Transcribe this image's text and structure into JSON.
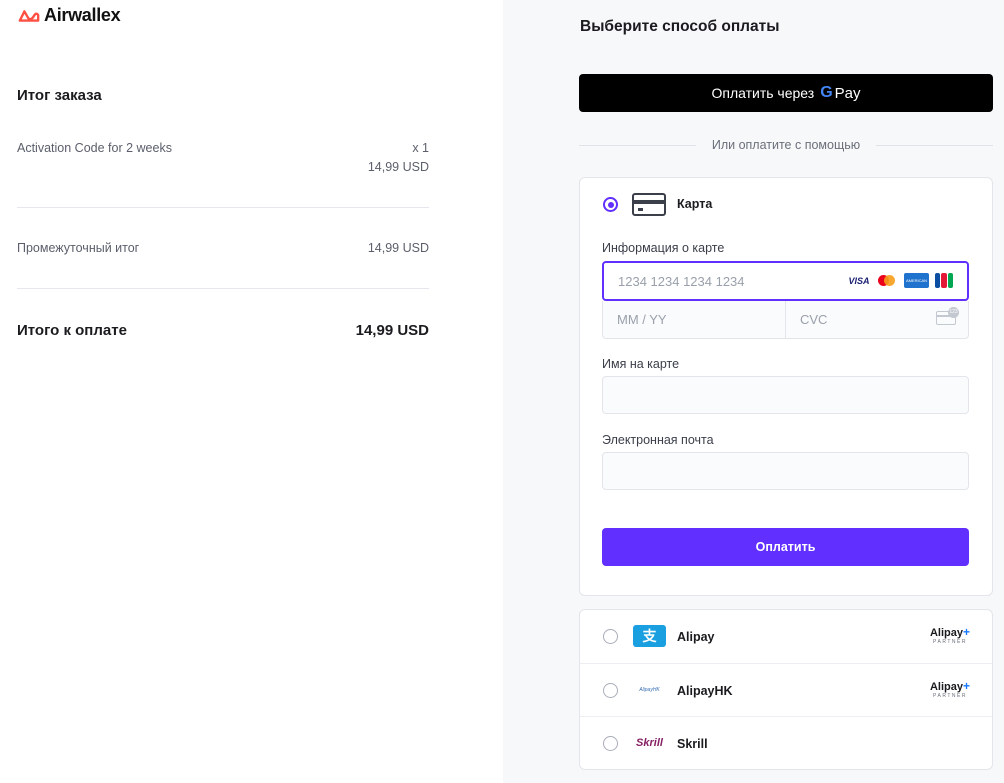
{
  "brand": {
    "name": "Airwallex",
    "accent": "#ff4f42"
  },
  "summary": {
    "title": "Итог заказа",
    "item": {
      "name": "Activation Code for 2 weeks",
      "qty": "x 1",
      "price": "14,99 USD"
    },
    "subtotal_label": "Промежуточный итог",
    "subtotal_value": "14,99 USD",
    "total_label": "Итого к оплате",
    "total_value": "14,99 USD"
  },
  "payment": {
    "title": "Выберите способ оплаты",
    "gpay_label": "Оплатить через",
    "gpay_g": "G",
    "gpay_pay": "Pay",
    "or_text": "Или оплатите с помощью",
    "card": {
      "label": "Карта",
      "info_label": "Информация о карте",
      "number_placeholder": "1234 1234 1234 1234",
      "brands": [
        "VISA",
        "Mastercard",
        "American Express",
        "JCB"
      ],
      "expiry_placeholder": "MM / YY",
      "cvc_placeholder": "CVC",
      "name_label": "Имя на карте",
      "name_value": "",
      "email_label": "Электронная почта",
      "email_value": "",
      "submit_label": "Оплатить"
    },
    "methods": [
      {
        "label": "Alipay",
        "icon": "alipay-icon",
        "partner": "Alipay",
        "partner_sub": "PARTNER"
      },
      {
        "label": "AlipayHK",
        "icon": "alipayhk-icon",
        "partner": "Alipay",
        "partner_sub": "PARTNER"
      },
      {
        "label": "Skrill",
        "icon": "skrill-icon",
        "icon_text": "Skrill"
      }
    ],
    "accent": "#612fff"
  }
}
